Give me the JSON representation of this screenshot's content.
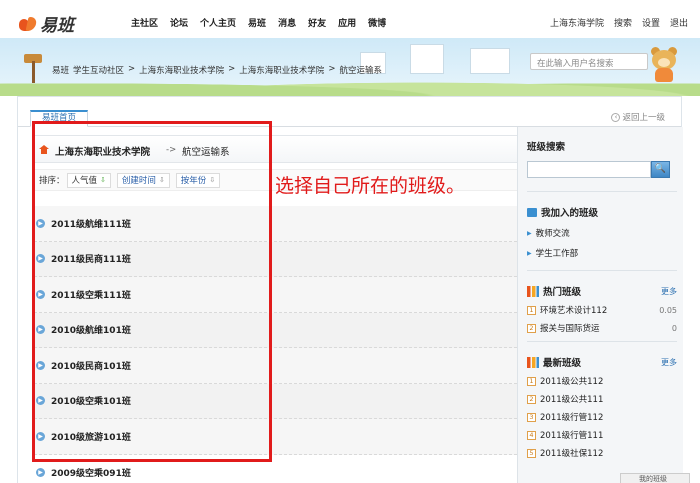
{
  "logo": {
    "text": "易班"
  },
  "nav": {
    "items": [
      "主社区",
      "论坛",
      "个人主页",
      "易班",
      "消息",
      "好友",
      "应用",
      "微博"
    ]
  },
  "topright": {
    "school": "上海东海学院",
    "search": "搜索",
    "settings": "设置",
    "logout": "退出"
  },
  "breadcrumb": [
    "易班",
    "学生互动社区",
    ">",
    "上海东海职业技术学院",
    ">",
    "上海东海职业技术学院",
    ">",
    "航空运输系"
  ],
  "user_search": {
    "placeholder": "在此输入用户名搜索"
  },
  "tabs": {
    "home": "易班首页",
    "back": "返回上一级"
  },
  "school_bar": {
    "school": "上海东海职业技术学院",
    "arrow": "->",
    "dept": "航空运输系"
  },
  "sort": {
    "label": "排序：",
    "options": [
      {
        "label": "人气值",
        "arrow": "⇩"
      },
      {
        "label": "创建时间",
        "arrow": "⇩"
      },
      {
        "label": "按年份",
        "arrow": "⇩"
      }
    ]
  },
  "classes": [
    "2011级航维111班",
    "2011级民商111班",
    "2011级空乘111班",
    "2010级航维101班",
    "2010级民商101班",
    "2010级空乘101班",
    "2010级旅游101班",
    "2009级空乘091班"
  ],
  "sidebar": {
    "class_search": {
      "title": "班级搜索",
      "button": "🔍"
    },
    "joined": {
      "title": "我加入的班级",
      "items": [
        "教师交流",
        "学生工作部"
      ]
    },
    "hot": {
      "title": "热门班级",
      "more": "更多",
      "items": [
        {
          "rank": "1",
          "name": "环境艺术设计112",
          "value": "0.05"
        },
        {
          "rank": "2",
          "name": "报关与国际货运",
          "value": "0"
        }
      ]
    },
    "newest": {
      "title": "最新班级",
      "more": "更多",
      "items": [
        {
          "rank": "1",
          "name": "2011级公共112"
        },
        {
          "rank": "2",
          "name": "2011级公共111"
        },
        {
          "rank": "3",
          "name": "2011级行管112"
        },
        {
          "rank": "4",
          "name": "2011级行管111"
        },
        {
          "rank": "5",
          "name": "2011级社保112"
        }
      ]
    }
  },
  "annotation": {
    "text": "选择自己所在的班级。",
    "color": "#e11b1b"
  },
  "bottom_peek": {
    "text": "我的班级"
  }
}
